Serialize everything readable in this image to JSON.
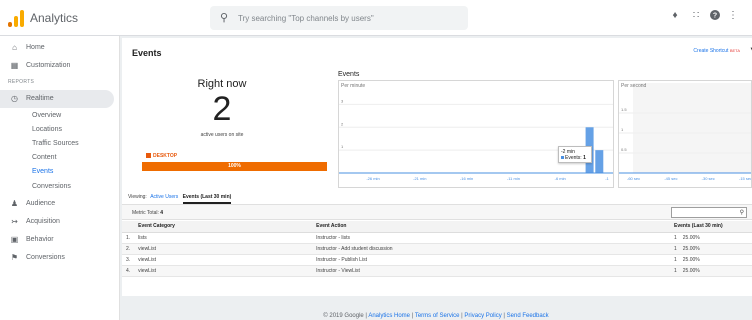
{
  "app": {
    "title": "Analytics",
    "logo_colors": [
      "#f9ab00",
      "#e37400",
      "#e8710a"
    ]
  },
  "search": {
    "placeholder": "Try searching \"Top channels by users\""
  },
  "topbar_icons": [
    "bell-icon",
    "apps-grid-icon",
    "help-icon",
    "more-vert-icon"
  ],
  "sidebar": {
    "home": "Home",
    "customization": "Customization",
    "section_reports": "REPORTS",
    "realtime": "Realtime",
    "realtime_items": [
      "Overview",
      "Locations",
      "Traffic Sources",
      "Content",
      "Events",
      "Conversions"
    ],
    "active_item": "Events",
    "audience": "Audience",
    "acquisition": "Acquisition",
    "behavior": "Behavior",
    "conversions": "Conversions"
  },
  "page": {
    "title": "Events",
    "create_shortcut": "Create Shortcut",
    "beta": "BETA"
  },
  "rightnow": {
    "label": "Right now",
    "count": "2",
    "subtitle": "active users on site",
    "device_label": "DESKTOP",
    "device_percent": "100%",
    "device_color": "#ef6c00"
  },
  "chart_data": [
    {
      "type": "bar",
      "title": "Events",
      "ylabel": "Per minute",
      "yticks": [
        "3",
        "2",
        "1"
      ],
      "xticks": [
        "-26 min",
        "-21 min",
        "-16 min",
        "-11 min",
        "-6 min",
        "-1"
      ],
      "ylim": [
        0,
        3.5
      ],
      "x": [
        -2,
        -1
      ],
      "values": [
        2,
        1
      ],
      "tooltip": {
        "time": "-2 min",
        "series": "Events",
        "value": "1"
      },
      "color": "#4a90e2"
    },
    {
      "type": "bar",
      "ylabel": "Per second",
      "yticks": [
        "1.5",
        "1",
        "0.5"
      ],
      "xticks": [
        "-60 sec",
        "-45 sec",
        "-30 sec",
        "-15 sec"
      ],
      "ylim": [
        0,
        2
      ],
      "values": []
    }
  ],
  "tabs": {
    "viewing_label": "Viewing:",
    "active_users": "Active Users",
    "events_current": "Events (Last 30 min)"
  },
  "metric": {
    "label": "Metric Total:",
    "value": "4"
  },
  "table": {
    "columns": [
      "Event Category",
      "Event Action",
      "Events (Last 30 min)"
    ],
    "rows": [
      {
        "n": "1.",
        "category": "lists",
        "action": "Instructor - lists",
        "events": "1",
        "pct": "25.00%"
      },
      {
        "n": "2.",
        "category": "viewList",
        "action": "Instructor - Add student discussion",
        "events": "1",
        "pct": "25.00%"
      },
      {
        "n": "3.",
        "category": "viewList",
        "action": "Instructor - Publish List",
        "events": "1",
        "pct": "25.00%"
      },
      {
        "n": "4.",
        "category": "viewList",
        "action": "Instructor - ViewList",
        "events": "1",
        "pct": "25.00%"
      }
    ]
  },
  "footer": {
    "copyright": "© 2019 Google |",
    "links": [
      "Analytics Home",
      "Terms of Service",
      "Privacy Policy",
      "Send Feedback"
    ]
  }
}
